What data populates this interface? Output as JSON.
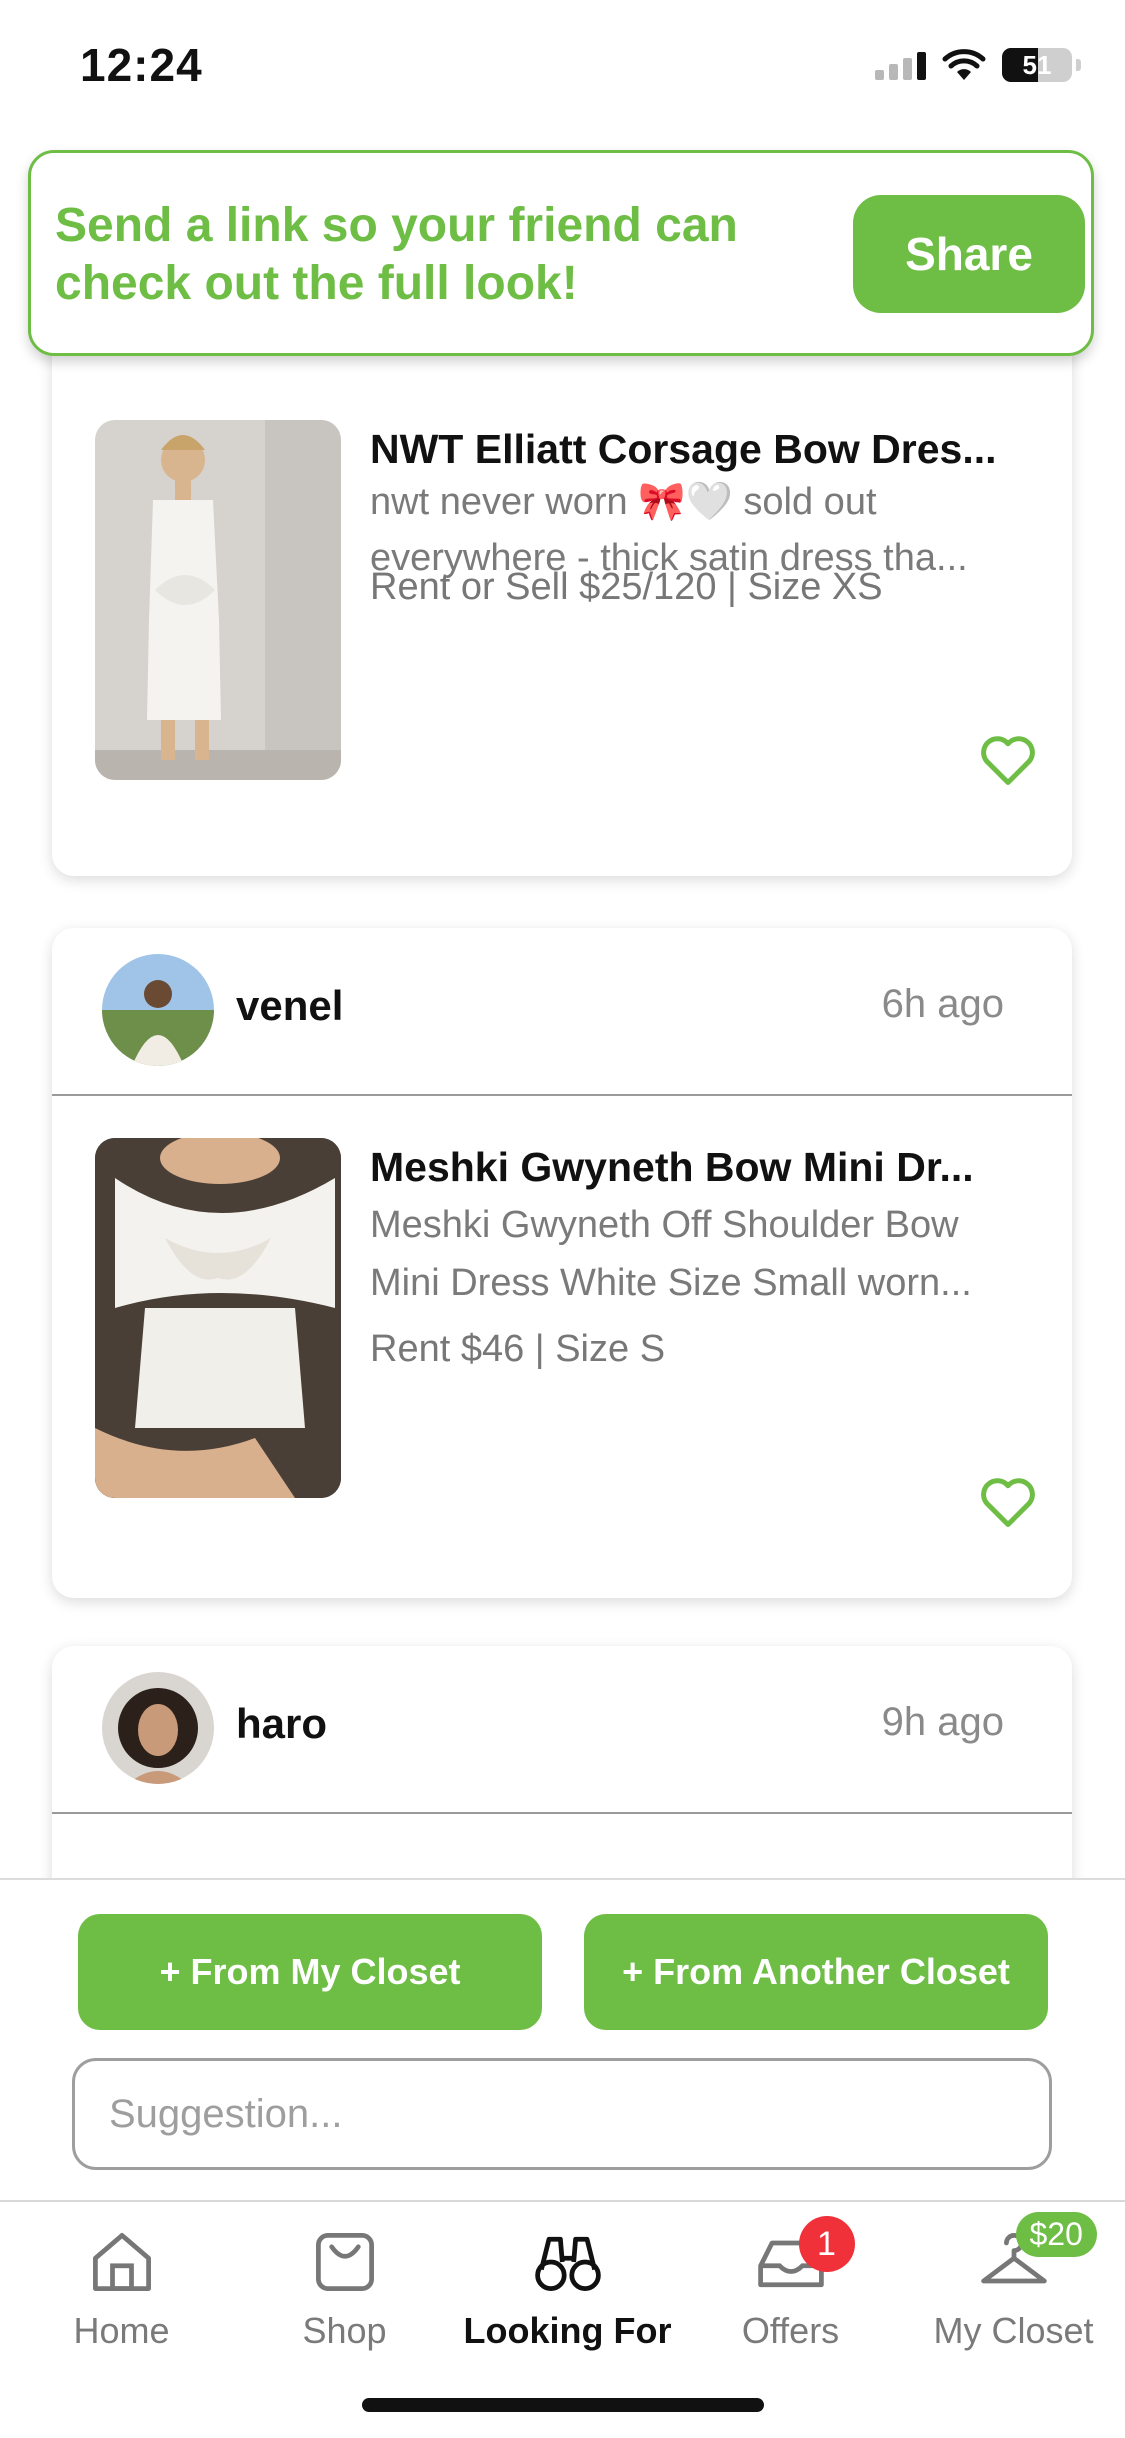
{
  "status_bar": {
    "time": "12:24",
    "battery": "51"
  },
  "share_banner": {
    "message": "Send a link so your friend can check out the full look!",
    "button_label": "Share"
  },
  "posts": [
    {
      "title": "NWT Elliatt Corsage Bow Dres...",
      "desc_line1": "nwt never worn 🎀🤍 sold out",
      "desc_line2": "everywhere - thick satin dress tha...",
      "price": "Rent or Sell $25/120 | Size XS"
    },
    {
      "user": "venel",
      "time_ago": "6h ago",
      "title": "Meshki Gwyneth Bow Mini Dr...",
      "desc_line1": "Meshki Gwyneth Off Shoulder Bow",
      "desc_line2": "Mini Dress White Size Small worn...",
      "price": "Rent $46 | Size S"
    },
    {
      "user": "haro",
      "time_ago": "9h ago"
    }
  ],
  "suggestion": {
    "from_my_closet": "+ From My Closet",
    "from_another_closet": "+ From Another Closet",
    "placeholder": "Suggestion..."
  },
  "tabs": [
    {
      "label": "Home",
      "icon": "home-icon"
    },
    {
      "label": "Shop",
      "icon": "shopping-bag-icon"
    },
    {
      "label": "Looking For",
      "icon": "binoculars-icon",
      "active": true
    },
    {
      "label": "Offers",
      "icon": "inbox-icon",
      "badge": "1"
    },
    {
      "label": "My Closet",
      "icon": "hanger-icon",
      "badge": "$20"
    }
  ],
  "colors": {
    "accent": "#6ebd45",
    "badge_red": "#f0313a"
  }
}
